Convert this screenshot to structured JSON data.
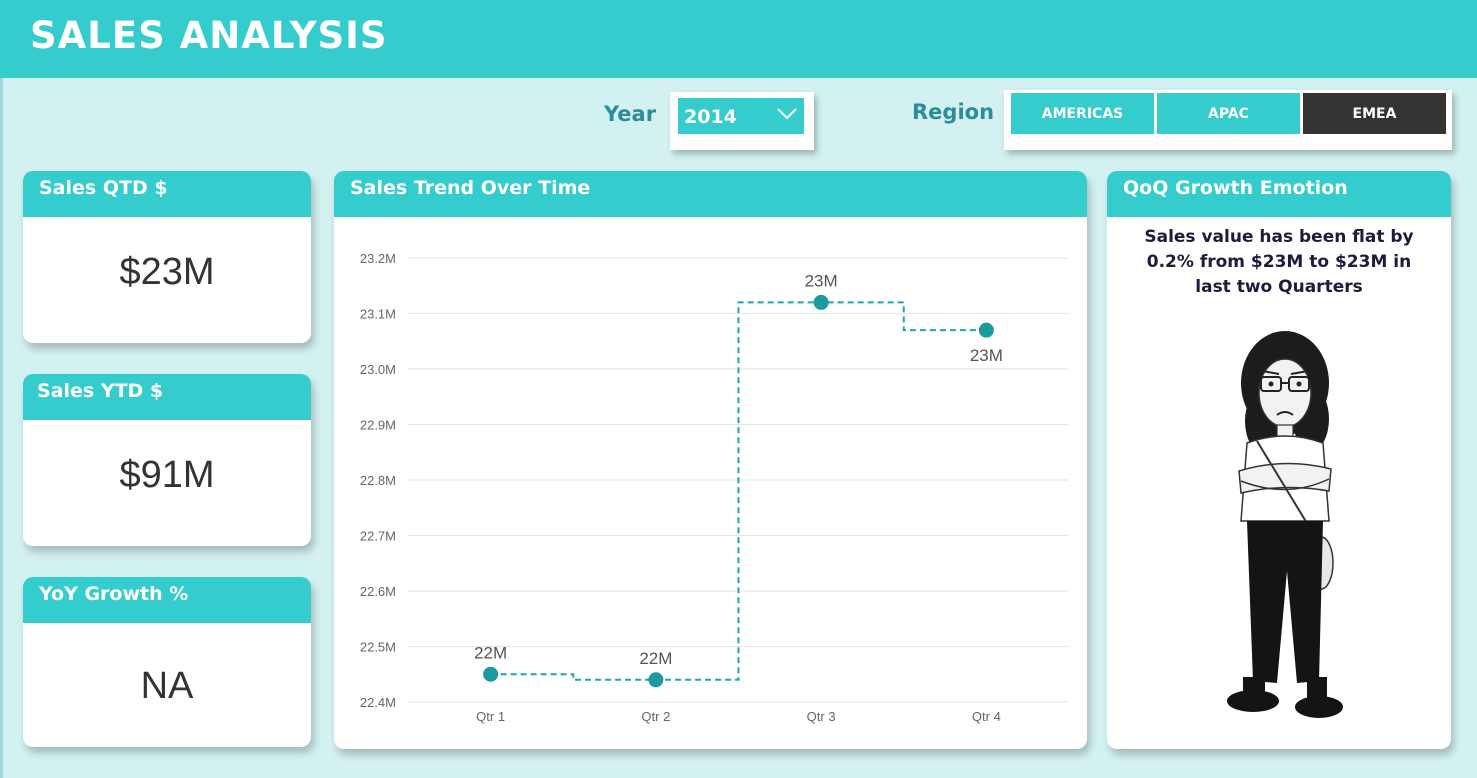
{
  "header": {
    "title": "SALES ANALYSIS"
  },
  "filters": {
    "year_label": "Year",
    "year_value": "2014",
    "region_label": "Region",
    "regions": [
      {
        "label": "AMERICAS",
        "selected": false
      },
      {
        "label": "APAC",
        "selected": false
      },
      {
        "label": "EMEA",
        "selected": true
      }
    ]
  },
  "kpis": {
    "sales_qtd": {
      "title": "Sales QTD $",
      "value": "$23M"
    },
    "sales_ytd": {
      "title": "Sales YTD $",
      "value": "$91M"
    },
    "yoy_growth": {
      "title": "YoY Growth %",
      "value": "NA"
    }
  },
  "trend": {
    "title": "Sales Trend Over Time"
  },
  "emotion": {
    "title": "QoQ Growth Emotion",
    "text": "Sales value has been flat by 0.2% from $23M to $23M in last two Quarters"
  },
  "colors": {
    "accent": "#35cccd",
    "line": "#1da8a8",
    "marker": "#1b9aa0",
    "selected": "#333333",
    "background": "#d3f1f1"
  },
  "chart_data": {
    "type": "line",
    "title": "Sales Trend Over Time",
    "categories": [
      "Qtr 1",
      "Qtr 2",
      "Qtr 3",
      "Qtr 4"
    ],
    "values": [
      22.45,
      22.44,
      23.12,
      23.07
    ],
    "data_labels": [
      "22M",
      "22M",
      "23M",
      "23M"
    ],
    "ylim": [
      22.4,
      23.2
    ],
    "yticks": [
      22.4,
      22.5,
      22.6,
      22.7,
      22.8,
      22.9,
      23.0,
      23.1,
      23.2
    ],
    "ytick_labels": [
      "22.4M",
      "22.5M",
      "22.6M",
      "22.7M",
      "22.8M",
      "22.9M",
      "23.0M",
      "23.1M",
      "23.2M"
    ],
    "line_style": "dashed-step",
    "grid": true
  }
}
